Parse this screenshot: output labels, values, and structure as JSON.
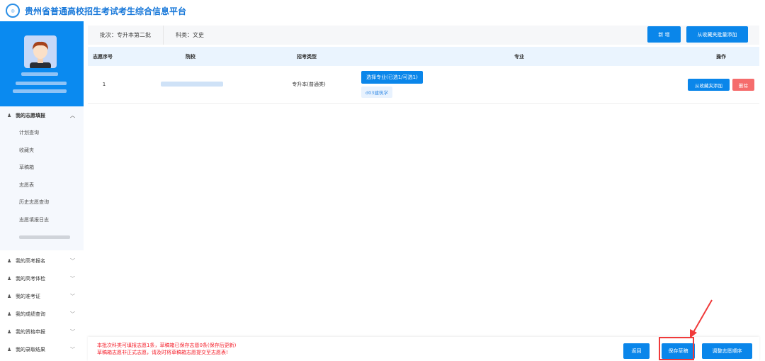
{
  "header": {
    "title": "贵州省普通高校招生考试考生综合信息平台",
    "logo_icon": "platform-logo"
  },
  "sidebar": {
    "active_group": {
      "label": "我的志愿填报",
      "items": [
        "计划查询",
        "收藏夹",
        "草稿箱",
        "志愿表",
        "历史志愿查询",
        "志愿填报日志"
      ]
    },
    "groups": [
      "我的高考报名",
      "我的高考体检",
      "我的准考证",
      "我的成绩查询",
      "我的资格申报",
      "我的录取结果"
    ]
  },
  "toolbar": {
    "batch": "批次：专升本第二批",
    "category": "科类：文史",
    "add": "新  增",
    "batch_add": "从收藏夹批量添加"
  },
  "table": {
    "columns": [
      "志愿序号",
      "院校",
      "招考类型",
      "专业",
      "操作"
    ],
    "rows": [
      {
        "index": "1",
        "type": "专升本(普通类)",
        "select_major": "选择专业(已选1/可选1)",
        "major": "d03建筑学",
        "add_from_fav": "从收藏夹添加",
        "delete": "删除"
      }
    ]
  },
  "bottom": {
    "notice1": "本批次科类可填报志愿1条，草稿箱已保存志愿0条(保存后更新)",
    "notice2": "草稿箱志愿非正式志愿，请及时将草稿箱志愿提交至志愿表!",
    "back": "返回",
    "save_draft": "保存草稿",
    "reorder": "调整志愿顺序"
  },
  "colors": {
    "primary": "#0a86ea",
    "danger": "#f56c6c",
    "notice": "#f5222d",
    "highlight": "#f03a3a"
  }
}
